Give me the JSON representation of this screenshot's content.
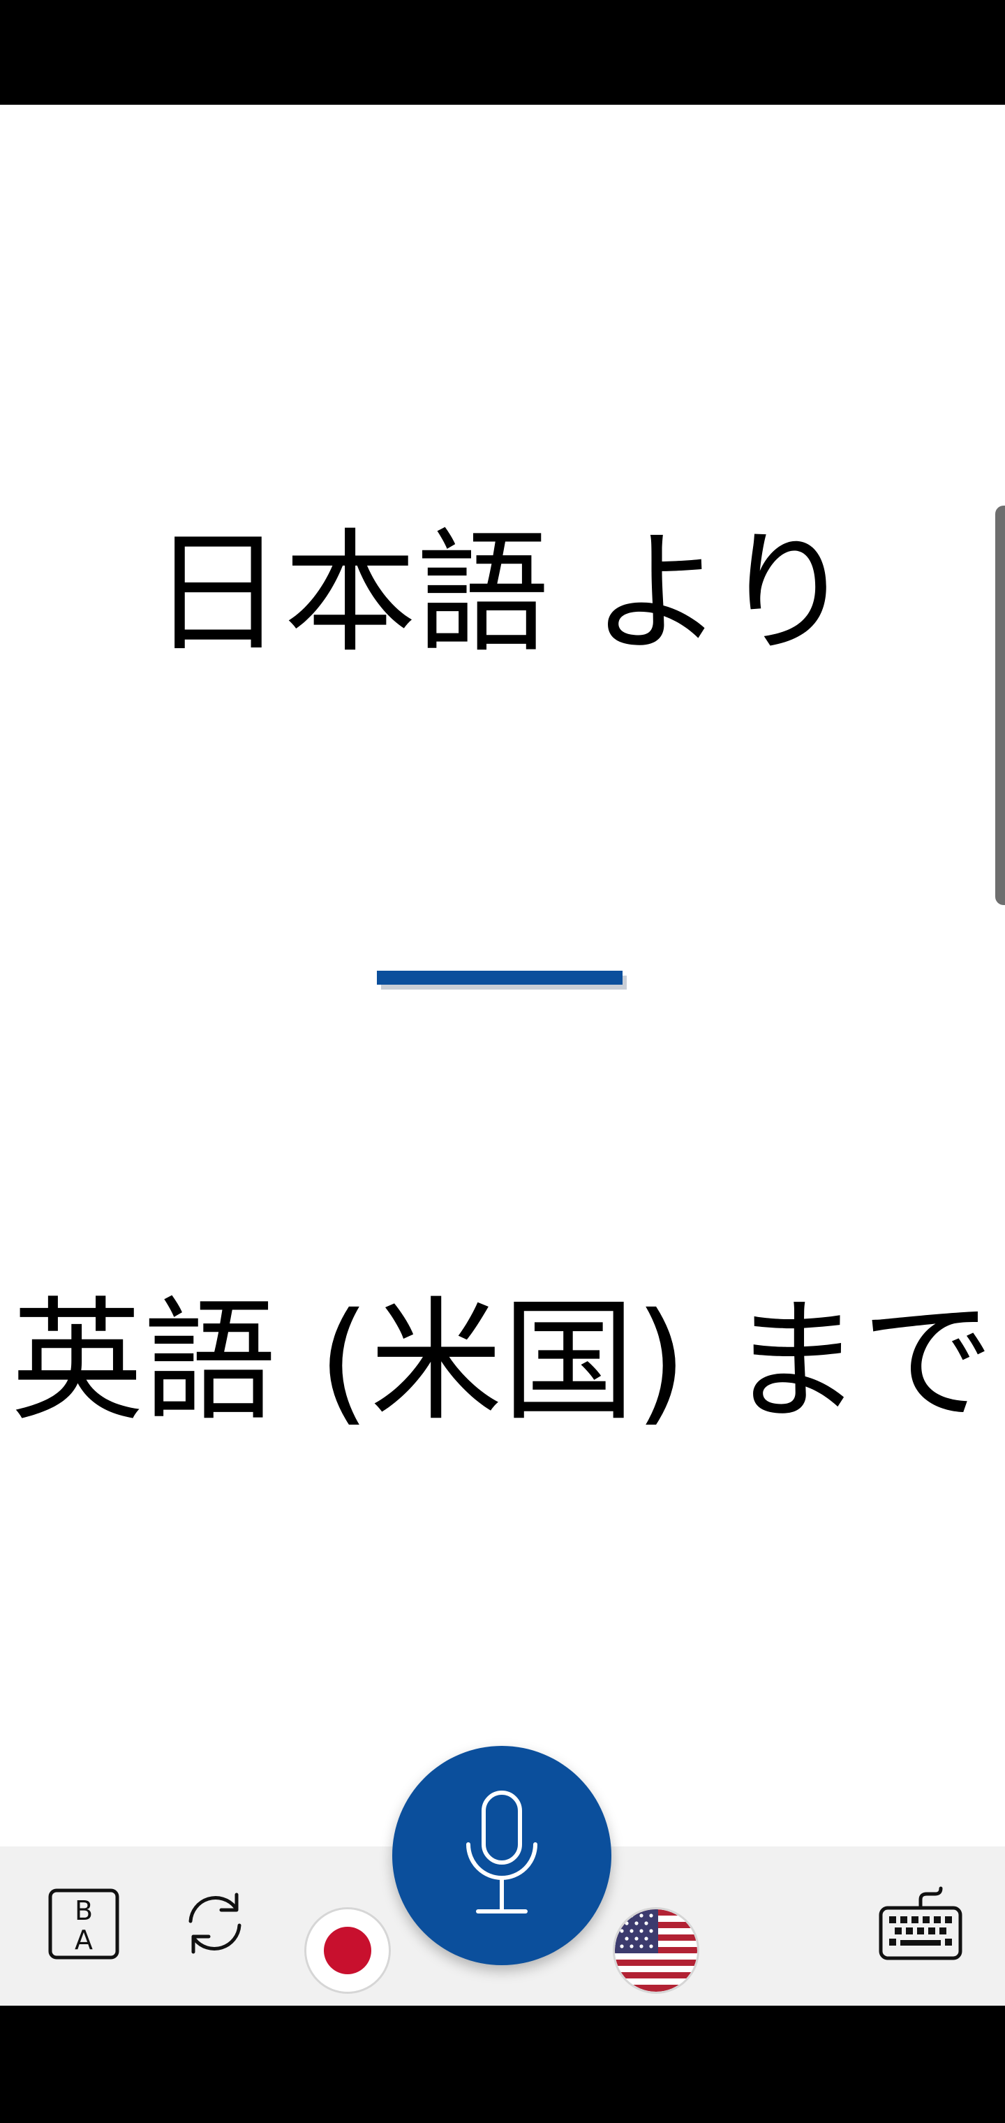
{
  "translation": {
    "source_label": "日本語 より",
    "target_label": "英語 (米国) まで"
  },
  "toolbar": {
    "text_mode_icon": "ba-text-icon",
    "swap_icon": "swap-languages-icon",
    "source_flag": "japan-flag",
    "mic_icon": "microphone-icon",
    "target_flag": "us-flag",
    "keyboard_icon": "keyboard-icon"
  },
  "colors": {
    "accent": "#0b4f9c",
    "toolbar_bg": "#f1f1f1",
    "japan_red": "#c8102e",
    "us_red": "#b22234",
    "us_blue": "#3c3b6e"
  }
}
